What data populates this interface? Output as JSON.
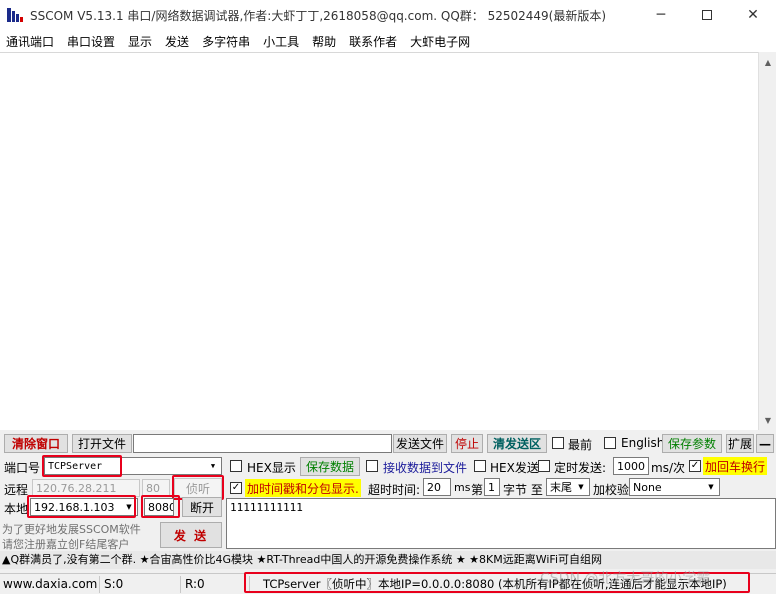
{
  "window": {
    "title": "SSCOM V5.13.1 串口/网络数据调试器,作者:大虾丁丁,2618058@qq.com. QQ群： 52502449(最新版本)",
    "minimize_icon": "minimize-icon",
    "maximize_icon": "maximize-icon",
    "close_icon": "close-icon"
  },
  "menu": {
    "items": [
      "通讯端口",
      "串口设置",
      "显示",
      "发送",
      "多字符串",
      "小工具",
      "帮助",
      "联系作者",
      "大虾电子网"
    ]
  },
  "toolbar": {
    "clear_window": "清除窗口",
    "open_file": "打开文件",
    "file_path": "",
    "send_file": "发送文件",
    "stop": "停止",
    "clear_send": "清发送区",
    "topmost": "最前",
    "english": "English",
    "save_params": "保存参数",
    "expand": "扩展",
    "collapse": "—"
  },
  "port": {
    "label": "端口号",
    "value": "TCPServer",
    "remote_label": "远程",
    "remote_ip": "120.76.28.211",
    "remote_port": "80",
    "listen_button": "侦听",
    "local_label": "本地",
    "local_ip": "192.168.1.103",
    "local_port": "8080",
    "disconnect_button": "断开"
  },
  "options": {
    "hex_display": "HEX显示",
    "hex_display_checked": false,
    "save_data": "保存数据",
    "receive_to_file": "接收数据到文件",
    "receive_to_file_checked": false,
    "hex_send": "HEX发送",
    "hex_send_checked": false,
    "timed_send": "定时发送:",
    "timed_send_checked": false,
    "interval": "1000",
    "interval_unit": "ms/次",
    "append_newline": "加回车换行",
    "append_newline_checked": true,
    "timestamp": "加时间戳和分包显示.",
    "timestamp_checked": true,
    "timeout_label": "超时时间:",
    "timeout_value": "20",
    "timeout_unit": "ms",
    "byte_label_pre": "第",
    "byte_index": "1",
    "byte_label_post": "字节 至",
    "byte_end": "末尾",
    "checksum_label": "加校验",
    "checksum_value": "None"
  },
  "promo": {
    "line1": "为了更好地发展SSCOM软件",
    "line2": "请您注册嘉立创F结尾客户"
  },
  "send": {
    "button": "发 送",
    "text": "11111111111"
  },
  "ticker": "▲Q群满员了,没有第二个群. ★合宙高性价比4G模块 ★RT-Thread中国人的开源免费操作系统 ★ ★8KM远距离WiFi可自组网",
  "status": {
    "site": "www.daxia.com",
    "sent": "S:0",
    "received": "R:0",
    "message": "TCPserver〖侦听中〗本地IP=0.0.0.0:8080 (本机所有IP都在侦听,连通后才能显示本地IP)"
  },
  "watermark": "CSDN @北方大哥的小学霸",
  "colors": {
    "highlight_red": "#e8001c",
    "yellow_fill": "#ffff00",
    "green_text": "#008000",
    "red_text": "#c00000"
  }
}
